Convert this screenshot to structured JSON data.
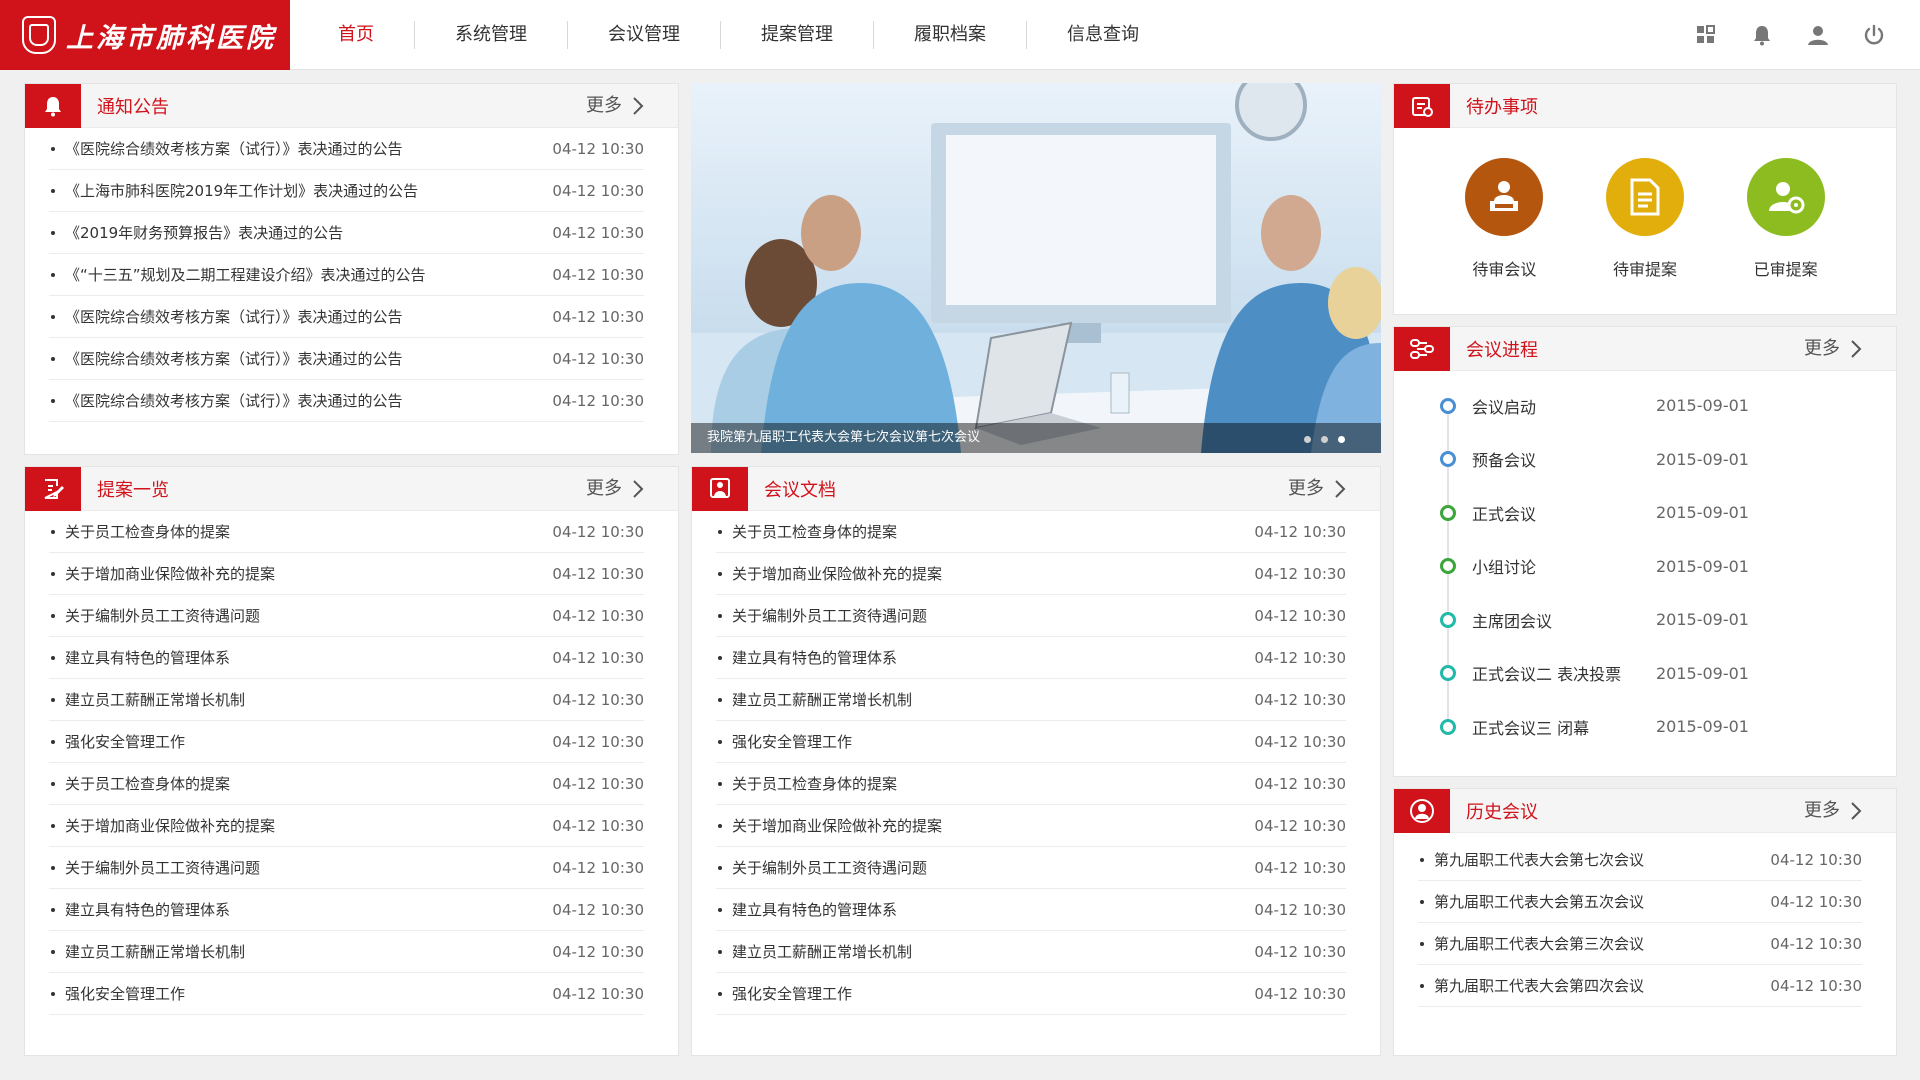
{
  "header": {
    "logo_text": "上海市肺科医院",
    "nav": [
      {
        "label": "首页",
        "active": true
      },
      {
        "label": "系统管理",
        "active": false
      },
      {
        "label": "会议管理",
        "active": false
      },
      {
        "label": "提案管理",
        "active": false
      },
      {
        "label": "履职档案",
        "active": false
      },
      {
        "label": "信息查询",
        "active": false
      }
    ],
    "icons": [
      "grid-icon",
      "bell-icon",
      "user-icon",
      "power-icon"
    ]
  },
  "notice": {
    "title": "通知公告",
    "more": "更多",
    "items": [
      {
        "title": "《医院综合绩效考核方案（试行）》表决通过的公告",
        "time": "04-12 10:30"
      },
      {
        "title": "《上海市肺科医院2019年工作计划》表决通过的公告",
        "time": "04-12 10:30"
      },
      {
        "title": "《2019年财务预算报告》表决通过的公告",
        "time": "04-12 10:30"
      },
      {
        "title": "《“十三五”规划及二期工程建设介绍》表决通过的公告",
        "time": "04-12 10:30"
      },
      {
        "title": "《医院综合绩效考核方案（试行）》表决通过的公告",
        "time": "04-12 10:30"
      },
      {
        "title": "《医院综合绩效考核方案（试行）》表决通过的公告",
        "time": "04-12 10:30"
      },
      {
        "title": "《医院综合绩效考核方案（试行）》表决通过的公告",
        "time": "04-12 10:30"
      }
    ]
  },
  "carousel": {
    "caption": "我院第九届职工代表大会第七次会议第七次会议",
    "slides": 3,
    "active_index": 2
  },
  "todo": {
    "title": "待办事项",
    "items": [
      {
        "label": "待审会议",
        "color": "#b5560f",
        "icon": "meeting-icon"
      },
      {
        "label": "待审提案",
        "color": "#e2ae0c",
        "icon": "document-icon"
      },
      {
        "label": "已审提案",
        "color": "#8cbc1f",
        "icon": "user-gear-icon"
      }
    ]
  },
  "progress": {
    "title": "会议进程",
    "more": "更多",
    "items": [
      {
        "name": "会议启动",
        "date": "2015-09-01",
        "color": "#4a8fd6"
      },
      {
        "name": "预备会议",
        "date": "2015-09-01",
        "color": "#4a8fd6"
      },
      {
        "name": "正式会议",
        "date": "2015-09-01",
        "color": "#3aa53a"
      },
      {
        "name": "小组讨论",
        "date": "2015-09-01",
        "color": "#3aa53a"
      },
      {
        "name": "主席团会议",
        "date": "2015-09-01",
        "color": "#21b9a8"
      },
      {
        "name": "正式会议二 表决投票",
        "date": "2015-09-01",
        "color": "#21b9a8"
      },
      {
        "name": "正式会议三 闭幕",
        "date": "2015-09-01",
        "color": "#21b9a8"
      }
    ]
  },
  "proposals": {
    "title": "提案一览",
    "more": "更多",
    "items": [
      {
        "title": "关于员工检查身体的提案",
        "time": "04-12 10:30"
      },
      {
        "title": "关于增加商业保险做补充的提案",
        "time": "04-12 10:30"
      },
      {
        "title": "关于编制外员工工资待遇问题",
        "time": "04-12 10:30"
      },
      {
        "title": "建立具有特色的管理体系",
        "time": "04-12 10:30"
      },
      {
        "title": "建立员工薪酬正常增长机制",
        "time": "04-12 10:30"
      },
      {
        "title": "强化安全管理工作",
        "time": "04-12 10:30"
      },
      {
        "title": "关于员工检查身体的提案",
        "time": "04-12 10:30"
      },
      {
        "title": "关于增加商业保险做补充的提案",
        "time": "04-12 10:30"
      },
      {
        "title": "关于编制外员工工资待遇问题",
        "time": "04-12 10:30"
      },
      {
        "title": "建立具有特色的管理体系",
        "time": "04-12 10:30"
      },
      {
        "title": "建立员工薪酬正常增长机制",
        "time": "04-12 10:30"
      },
      {
        "title": "强化安全管理工作",
        "time": "04-12 10:30"
      }
    ]
  },
  "documents": {
    "title": "会议文档",
    "more": "更多",
    "items": [
      {
        "title": "关于员工检查身体的提案",
        "time": "04-12 10:30"
      },
      {
        "title": "关于增加商业保险做补充的提案",
        "time": "04-12 10:30"
      },
      {
        "title": "关于编制外员工工资待遇问题",
        "time": "04-12 10:30"
      },
      {
        "title": "建立具有特色的管理体系",
        "time": "04-12 10:30"
      },
      {
        "title": "建立员工薪酬正常增长机制",
        "time": "04-12 10:30"
      },
      {
        "title": "强化安全管理工作",
        "time": "04-12 10:30"
      },
      {
        "title": "关于员工检查身体的提案",
        "time": "04-12 10:30"
      },
      {
        "title": "关于增加商业保险做补充的提案",
        "time": "04-12 10:30"
      },
      {
        "title": "关于编制外员工工资待遇问题",
        "time": "04-12 10:30"
      },
      {
        "title": "建立具有特色的管理体系",
        "time": "04-12 10:30"
      },
      {
        "title": "建立员工薪酬正常增长机制",
        "time": "04-12 10:30"
      },
      {
        "title": "强化安全管理工作",
        "time": "04-12 10:30"
      }
    ]
  },
  "history": {
    "title": "历史会议",
    "more": "更多",
    "items": [
      {
        "title": "第九届职工代表大会第七次会议",
        "time": "04-12 10:30"
      },
      {
        "title": "第九届职工代表大会第五次会议",
        "time": "04-12 10:30"
      },
      {
        "title": "第九届职工代表大会第三次会议",
        "time": "04-12 10:30"
      },
      {
        "title": "第九届职工代表大会第四次会议",
        "time": "04-12 10:30"
      }
    ]
  },
  "theme": {
    "accent": "#d0121b"
  }
}
